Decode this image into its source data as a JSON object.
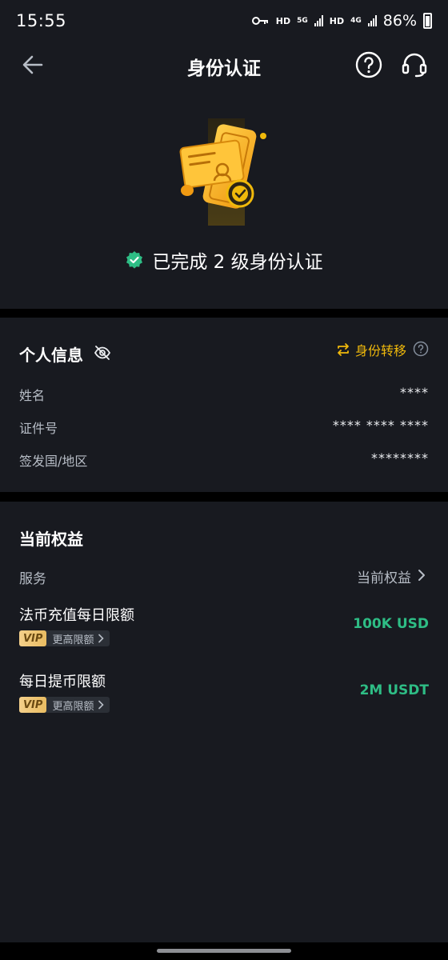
{
  "status_bar": {
    "time": "15:55",
    "hd1": "HD",
    "net1": "5G",
    "hd2": "HD",
    "net2": "4G",
    "battery": "86%"
  },
  "header": {
    "title": "身份认证"
  },
  "verification": {
    "status_text": "已完成 2 级身份认证"
  },
  "personal_info": {
    "title": "个人信息",
    "transfer_label": "身份转移",
    "rows": [
      {
        "label": "姓名",
        "value": "****"
      },
      {
        "label": "证件号",
        "value": "**** **** ****"
      },
      {
        "label": "签发国/地区",
        "value": "********"
      }
    ]
  },
  "benefits": {
    "title": "当前权益",
    "service_label": "服务",
    "service_value": "当前权益",
    "limits": [
      {
        "label": "法币充值每日限额",
        "value": "100K USD",
        "vip": "VIP",
        "vip_text": "更高限额"
      },
      {
        "label": "每日提币限额",
        "value": "2M USDT",
        "vip": "VIP",
        "vip_text": "更高限额"
      }
    ]
  },
  "colors": {
    "accent": "#f0b90b",
    "success": "#2ebd85",
    "panel": "#181a20"
  }
}
